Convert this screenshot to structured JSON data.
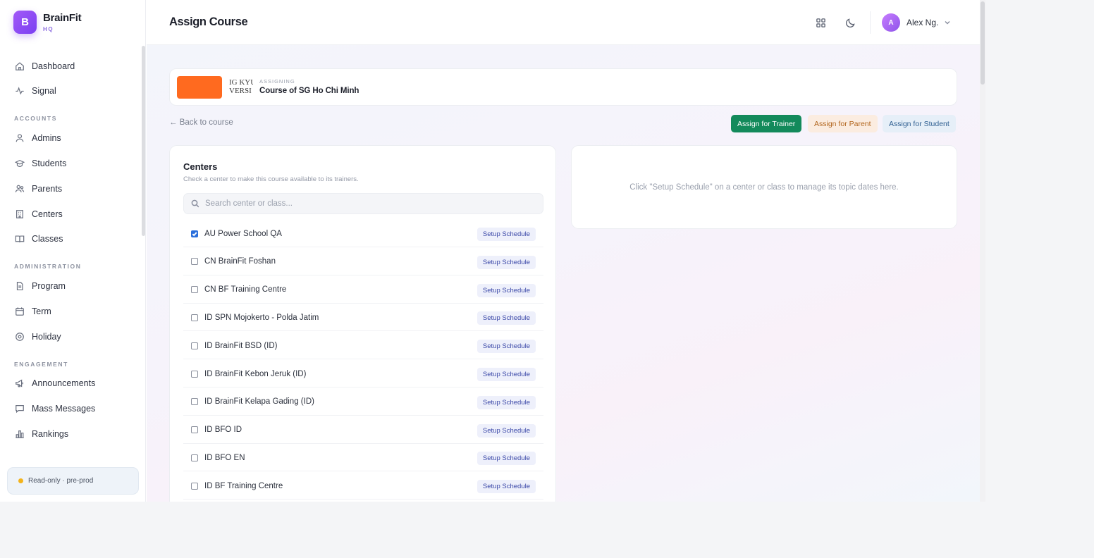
{
  "brand": {
    "logo_letter": "B",
    "name": "BrainFit",
    "sub": "HQ",
    "accent": "#7b3ff2"
  },
  "sidebar": {
    "items": [
      {
        "key": "dashboard",
        "label": "Dashboard",
        "icon": "home-icon"
      },
      {
        "key": "signal",
        "label": "Signal",
        "icon": "signal-icon"
      }
    ],
    "sections": [
      {
        "title": "ACCOUNTS",
        "items": [
          {
            "key": "admins",
            "label": "Admins",
            "icon": "users-icon"
          },
          {
            "key": "students",
            "label": "Students",
            "icon": "graduation-cap-icon"
          },
          {
            "key": "parents",
            "label": "Parents",
            "icon": "user-group-icon"
          },
          {
            "key": "centers",
            "label": "Centers",
            "icon": "building-icon"
          },
          {
            "key": "classes",
            "label": "Classes",
            "icon": "book-icon"
          }
        ]
      },
      {
        "title": "ADMINISTRATION",
        "items": [
          {
            "key": "program",
            "label": "Program",
            "icon": "document-icon"
          },
          {
            "key": "term",
            "label": "Term",
            "icon": "calendar-icon"
          },
          {
            "key": "holiday",
            "label": "Holiday",
            "icon": "circle-badge-icon"
          }
        ]
      },
      {
        "title": "ENGAGEMENT",
        "items": [
          {
            "key": "announcements",
            "label": "Announcements",
            "icon": "megaphone-icon"
          },
          {
            "key": "mass_messages",
            "label": "Mass Messages",
            "icon": "chat-icon"
          },
          {
            "key": "rankings",
            "label": "Rankings",
            "icon": "bar-chart-icon"
          }
        ]
      }
    ],
    "readonly_badge": "Read-only · pre-prod",
    "status_color": "#f3b31b"
  },
  "header": {
    "title": "Assign Course",
    "user": {
      "initial": "A",
      "name": "Alex Ng."
    }
  },
  "course": {
    "thumb_text": [
      "IG KYU",
      "VERSI"
    ],
    "assigning_label": "ASSIGNING",
    "name": "Course of SG Ho Chi Minh",
    "thumb_color": "#ff6a1f"
  },
  "actions": {
    "back": "← Back to course",
    "assign_trainer": "Assign for Trainer",
    "assign_parent": "Assign for Parent",
    "assign_student": "Assign for Student"
  },
  "centers": {
    "title": "Centers",
    "subtitle": "Check a center to make this course available to its trainers.",
    "search_placeholder": "Search center or class...",
    "setup_label": "Setup Schedule",
    "rows": [
      {
        "name": "AU Power School QA",
        "checked": true
      },
      {
        "name": "CN BrainFit Foshan",
        "checked": false
      },
      {
        "name": "CN BF Training Centre",
        "checked": false
      },
      {
        "name": "ID SPN Mojokerto - Polda Jatim",
        "checked": false
      },
      {
        "name": "ID BrainFit BSD (ID)",
        "checked": false
      },
      {
        "name": "ID BrainFit Kebon Jeruk (ID)",
        "checked": false
      },
      {
        "name": "ID BrainFit Kelapa Gading (ID)",
        "checked": false
      },
      {
        "name": "ID BFO ID",
        "checked": false
      },
      {
        "name": "ID BFO EN",
        "checked": false
      },
      {
        "name": "ID BF Training Centre",
        "checked": false
      }
    ]
  },
  "schedule": {
    "hint": "Click \"Setup Schedule\" on a center or class to manage its topic dates here."
  }
}
